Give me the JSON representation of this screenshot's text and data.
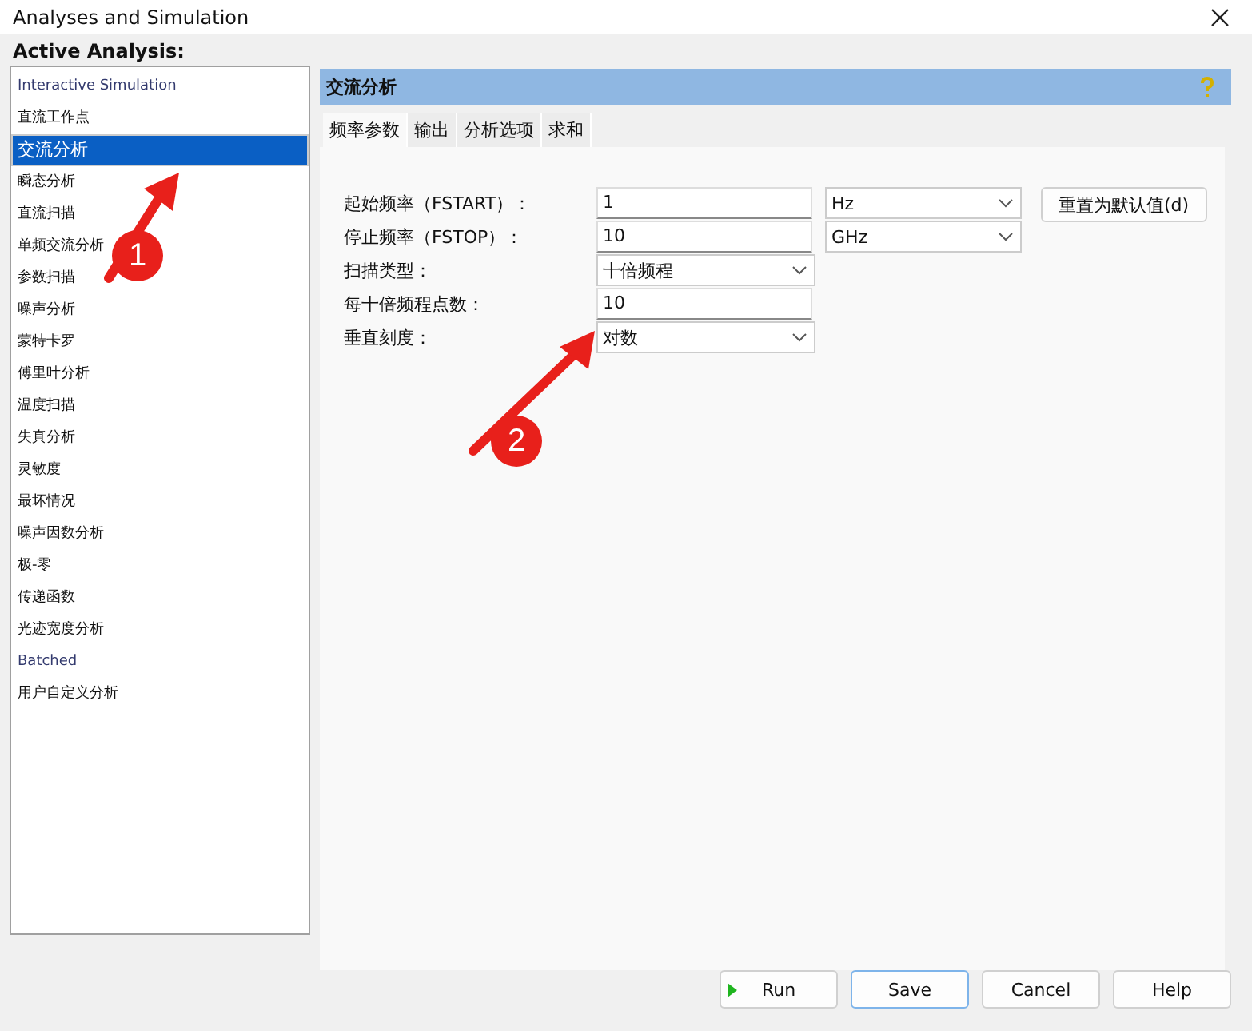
{
  "window": {
    "title": "Analyses and Simulation"
  },
  "sidebar": {
    "heading": "Active Analysis:",
    "items": [
      {
        "label": "Interactive Simulation",
        "selected": false,
        "kind": "english"
      },
      {
        "label": "直流工作点",
        "selected": false,
        "kind": "normal"
      },
      {
        "label": "交流分析",
        "selected": true,
        "kind": "normal"
      },
      {
        "label": "瞬态分析",
        "selected": false,
        "kind": "normal"
      },
      {
        "label": "直流扫描",
        "selected": false,
        "kind": "normal"
      },
      {
        "label": "单频交流分析",
        "selected": false,
        "kind": "normal"
      },
      {
        "label": "参数扫描",
        "selected": false,
        "kind": "normal"
      },
      {
        "label": "噪声分析",
        "selected": false,
        "kind": "normal"
      },
      {
        "label": "蒙特卡罗",
        "selected": false,
        "kind": "normal"
      },
      {
        "label": "傅里叶分析",
        "selected": false,
        "kind": "normal"
      },
      {
        "label": "温度扫描",
        "selected": false,
        "kind": "normal"
      },
      {
        "label": "失真分析",
        "selected": false,
        "kind": "normal"
      },
      {
        "label": "灵敏度",
        "selected": false,
        "kind": "normal"
      },
      {
        "label": "最坏情况",
        "selected": false,
        "kind": "normal"
      },
      {
        "label": "噪声因数分析",
        "selected": false,
        "kind": "normal"
      },
      {
        "label": "极-零",
        "selected": false,
        "kind": "normal"
      },
      {
        "label": "传递函数",
        "selected": false,
        "kind": "normal"
      },
      {
        "label": "光迹宽度分析",
        "selected": false,
        "kind": "normal"
      },
      {
        "label": "Batched",
        "selected": false,
        "kind": "english"
      },
      {
        "label": "用户自定义分析",
        "selected": false,
        "kind": "normal"
      }
    ]
  },
  "panel": {
    "title": "交流分析",
    "tabs": [
      {
        "label": "频率参数",
        "selected": true
      },
      {
        "label": "输出",
        "selected": false
      },
      {
        "label": "分析选项",
        "selected": false
      },
      {
        "label": "求和",
        "selected": false
      }
    ],
    "fields": [
      {
        "label": "起始频率（FSTART）：",
        "kind": "input",
        "value": "1",
        "unit": "Hz"
      },
      {
        "label": "停止频率（FSTOP）：",
        "kind": "input",
        "value": "10",
        "unit": "GHz"
      },
      {
        "label": "扫描类型：",
        "kind": "select",
        "value": "十倍频程"
      },
      {
        "label": "每十倍频程点数：",
        "kind": "input",
        "value": "10"
      },
      {
        "label": "垂直刻度：",
        "kind": "select",
        "value": "对数"
      }
    ],
    "reset_button": "重置为默认值(d)"
  },
  "buttons": [
    {
      "label": "Run",
      "kind": "run",
      "selected": false
    },
    {
      "label": "Save",
      "kind": "plain",
      "selected": true
    },
    {
      "label": "Cancel",
      "kind": "plain",
      "selected": false
    },
    {
      "label": "Help",
      "kind": "plain",
      "selected": false
    }
  ],
  "annotations": [
    {
      "label": "1"
    },
    {
      "label": "2"
    }
  ]
}
